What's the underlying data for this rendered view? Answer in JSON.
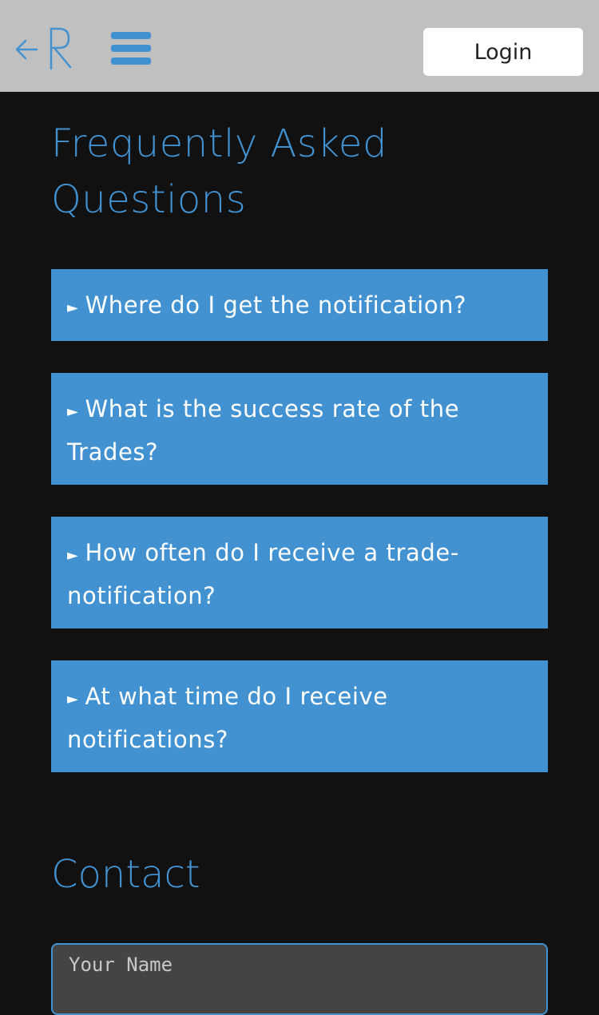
{
  "header": {
    "logo_name": "R",
    "login_label": "Login"
  },
  "faq": {
    "title": "Frequently Asked Questions",
    "arrow": "►",
    "items": [
      {
        "question": "Where do I get the notification?"
      },
      {
        "question": "What is the success rate of the Trades?"
      },
      {
        "question": "How often do I receive a trade-notification?"
      },
      {
        "question": "At what time do I receive notifications?"
      }
    ]
  },
  "contact": {
    "title": "Contact",
    "name_placeholder": "Your Name"
  },
  "colors": {
    "accent": "#4292d2",
    "background": "#111111",
    "header_bg": "#c0c0c0"
  }
}
